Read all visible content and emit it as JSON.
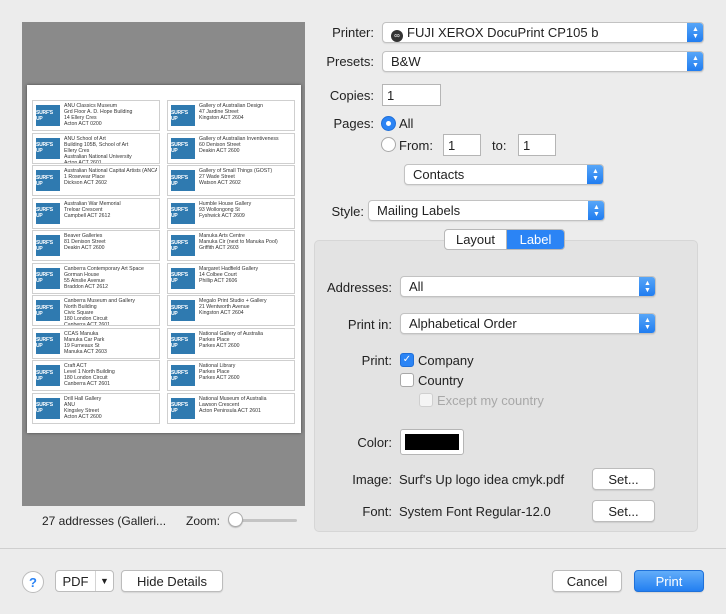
{
  "preview": {
    "labels": [
      {
        "logo": "SURF'S UP",
        "lines": [
          "ANU Classics Museum",
          "Grd Floor A. D. Hope Building",
          "14 Ellery Cres",
          "Acton ACT 0200"
        ]
      },
      {
        "logo": "SURF'S UP",
        "lines": [
          "Gallery of Australian Design",
          "47 Jardine Street",
          "Kingston ACT 2604"
        ]
      },
      {
        "logo": "SURF'S UP",
        "lines": [
          "ANU School of Art",
          "Building 105B, School of Art",
          "Ellery Cres",
          "Australian National University",
          "Acton ACT 2601"
        ]
      },
      {
        "logo": "SURF'S UP",
        "lines": [
          "Gallery of Australian Inventiveness",
          "60 Denison Street",
          "Deakin ACT 2600"
        ]
      },
      {
        "logo": "SURF'S UP",
        "lines": [
          "Australian National Capital Artists (ANCA)",
          "1 Rosevear Place",
          "Dickson ACT 2602"
        ]
      },
      {
        "logo": "SURF'S UP",
        "lines": [
          "Gallery of Small Things (GOST)",
          "27 Wade Street",
          "Watson ACT 2602"
        ]
      },
      {
        "logo": "SURF'S UP",
        "lines": [
          "Australian War Memorial",
          "Treloar Crescent",
          "Campbell ACT 2612"
        ]
      },
      {
        "logo": "SURF'S UP",
        "lines": [
          "Humble House Gallery",
          "93 Wollongong St",
          "Fyshwick ACT 2609"
        ]
      },
      {
        "logo": "SURF'S UP",
        "lines": [
          "Beaver Galleries",
          "81 Denison Street",
          "Deakin ACT 2600"
        ]
      },
      {
        "logo": "SURF'S UP",
        "lines": [
          "Manuka Arts Centre",
          "Manuka Cir (next to Manuka Pool)",
          "Griffith ACT 2603"
        ]
      },
      {
        "logo": "SURF'S UP",
        "lines": [
          "Canberra Contemporary Art Space",
          "Gorman House",
          "55 Ainslie Avenue",
          "Braddon ACT 2612"
        ]
      },
      {
        "logo": "SURF'S UP",
        "lines": [
          "Margaret Hadfield Gallery",
          "14 Colbee Court",
          "Phillip ACT 2606"
        ]
      },
      {
        "logo": "SURF'S UP",
        "lines": [
          "Canberra Museum and Gallery",
          "North Building",
          "Civic Square",
          "180 London Circuit",
          "Canberra ACT 2601"
        ]
      },
      {
        "logo": "SURF'S UP",
        "lines": [
          "Megalo Print Studio + Gallery",
          "21 Wentworth Avenue",
          "Kingston ACT 2604"
        ]
      },
      {
        "logo": "SURF'S UP",
        "lines": [
          "CCAS Manuka",
          "Manuka Car Park",
          "19 Furneaux St",
          "Manuka ACT 2603"
        ]
      },
      {
        "logo": "SURF'S UP",
        "lines": [
          "National Gallery of Australia",
          "Parkes Place",
          "Parkes ACT 2600"
        ]
      },
      {
        "logo": "SURF'S UP",
        "lines": [
          "Craft ACT",
          "Level 1 North Building",
          "180 London Circuit",
          "Canberra ACT 2601"
        ]
      },
      {
        "logo": "SURF'S UP",
        "lines": [
          "National Library",
          "Parkes Place",
          "Parkes ACT 2600"
        ]
      },
      {
        "logo": "SURF'S UP",
        "lines": [
          "Drill Hall Gallery",
          "ANU",
          "Kingsley Street",
          "Acton ACT 2600"
        ]
      },
      {
        "logo": "SURF'S UP",
        "lines": [
          "National Museum of Australia",
          "Lawson Crescent",
          "Acton Peninsula ACT 2601"
        ]
      }
    ],
    "address_count": "27 addresses (Galleri...",
    "zoom_label": "Zoom:",
    "zoom_level": 0
  },
  "printer": {
    "label": "Printer:",
    "value": "FUJI XEROX DocuPrint CP105 b"
  },
  "presets": {
    "label": "Presets:",
    "value": "B&W"
  },
  "copies": {
    "label": "Copies:",
    "value": "1"
  },
  "pages": {
    "label": "Pages:",
    "all_label": "All",
    "from_label": "From:",
    "from_value": "1",
    "to_label": "to:",
    "to_value": "1",
    "selected": "All"
  },
  "section_popup": {
    "value": "Contacts"
  },
  "style": {
    "label": "Style:",
    "value": "Mailing Labels"
  },
  "tabs": {
    "layout": "Layout",
    "label": "Label",
    "selected": "Label"
  },
  "addresses": {
    "label": "Addresses:",
    "value": "All"
  },
  "print_in": {
    "label": "Print in:",
    "value": "Alphabetical Order"
  },
  "print_options": {
    "label": "Print:",
    "company": {
      "label": "Company",
      "checked": true
    },
    "country": {
      "label": "Country",
      "checked": false
    },
    "except_my_country": {
      "label": "Except my country",
      "checked": false,
      "enabled": false
    }
  },
  "color": {
    "label": "Color:",
    "value": "#000000"
  },
  "image": {
    "label": "Image:",
    "value": "Surf's Up logo idea cmyk.pdf",
    "button": "Set..."
  },
  "font": {
    "label": "Font:",
    "value": "System Font Regular-12.0",
    "button": "Set..."
  },
  "footer": {
    "help": "?",
    "pdf": "PDF",
    "hide_details": "Hide Details",
    "cancel": "Cancel",
    "print": "Print"
  },
  "colors": {
    "accent": "#2b84f5",
    "logo_blue": "#2f7ab0",
    "preview_bg": "#8a8a8a"
  }
}
